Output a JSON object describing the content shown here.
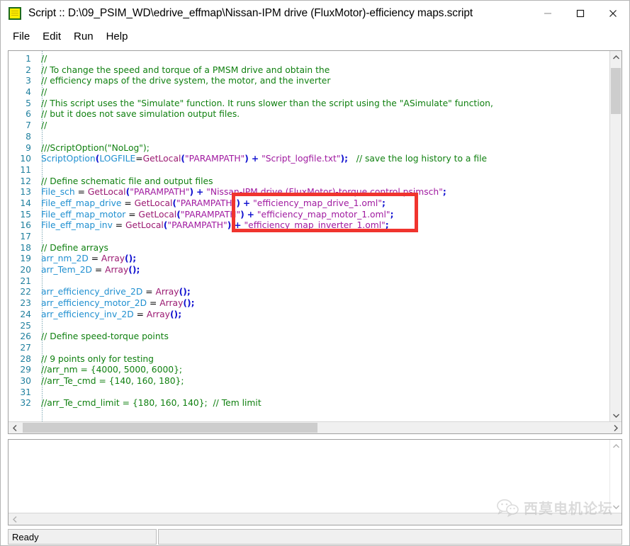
{
  "window": {
    "title": "Script :: D:\\09_PSIM_WD\\edrive_effmap\\Nissan-IPM drive (FluxMotor)-efficiency maps.script",
    "icon": "script-document-icon",
    "controls": {
      "minimize": "minimize-icon",
      "maximize": "maximize-icon",
      "close": "close-icon"
    }
  },
  "menubar": {
    "items": [
      {
        "label": "File"
      },
      {
        "label": "Edit"
      },
      {
        "label": "Run"
      },
      {
        "label": "Help"
      }
    ]
  },
  "editor": {
    "first_line": 1,
    "last_line": 32,
    "lines": [
      {
        "n": "1",
        "tokens": [
          {
            "t": "//",
            "c": "ct"
          }
        ]
      },
      {
        "n": "2",
        "tokens": [
          {
            "t": "// To change the speed and torque of a PMSM drive and obtain the",
            "c": "ct"
          }
        ]
      },
      {
        "n": "3",
        "tokens": [
          {
            "t": "// efficiency maps of the drive system, the motor, and the inverter",
            "c": "ct"
          }
        ]
      },
      {
        "n": "4",
        "tokens": [
          {
            "t": "//",
            "c": "ct"
          }
        ]
      },
      {
        "n": "5",
        "tokens": [
          {
            "t": "// This script uses the \"Simulate\" function. It runs slower than the script using the \"ASimulate\" function,",
            "c": "ct"
          }
        ]
      },
      {
        "n": "6",
        "tokens": [
          {
            "t": "// but it does not save simulation output files.",
            "c": "ct"
          }
        ]
      },
      {
        "n": "7",
        "tokens": [
          {
            "t": "//",
            "c": "ct"
          }
        ]
      },
      {
        "n": "8",
        "tokens": []
      },
      {
        "n": "9",
        "tokens": [
          {
            "t": "///ScriptOption(\"NoLog\");",
            "c": "ct"
          }
        ]
      },
      {
        "n": "10",
        "tokens": [
          {
            "t": "ScriptOption",
            "c": "id"
          },
          {
            "t": "(",
            "c": "pn"
          },
          {
            "t": "LOGFILE",
            "c": "id"
          },
          {
            "t": "=",
            "c": "op"
          },
          {
            "t": "GetLocal",
            "c": "fn"
          },
          {
            "t": "(",
            "c": "pn"
          },
          {
            "t": "\"PARAMPATH\"",
            "c": "st"
          },
          {
            "t": ")",
            "c": "pn"
          },
          {
            "t": " ",
            "c": "op"
          },
          {
            "t": "+",
            "c": "pn"
          },
          {
            "t": " ",
            "c": "op"
          },
          {
            "t": "\"Script_logfile.txt\"",
            "c": "st"
          },
          {
            "t": ")",
            "c": "pn"
          },
          {
            "t": ";",
            "c": "pn"
          },
          {
            "t": "   ",
            "c": "op"
          },
          {
            "t": "// save the log history to a file",
            "c": "ct"
          }
        ]
      },
      {
        "n": "11",
        "tokens": []
      },
      {
        "n": "12",
        "tokens": [
          {
            "t": "// Define schematic file and output files",
            "c": "ct"
          }
        ]
      },
      {
        "n": "13",
        "tokens": [
          {
            "t": "File_sch",
            "c": "id"
          },
          {
            "t": " = ",
            "c": "op"
          },
          {
            "t": "GetLocal",
            "c": "fn"
          },
          {
            "t": "(",
            "c": "pn"
          },
          {
            "t": "\"PARAMPATH\"",
            "c": "st"
          },
          {
            "t": ")",
            "c": "pn"
          },
          {
            "t": " ",
            "c": "op"
          },
          {
            "t": "+",
            "c": "pn"
          },
          {
            "t": " ",
            "c": "op"
          },
          {
            "t": "\"Nissan-IPM drive (FluxMotor)-torque control.psimsch\"",
            "c": "st"
          },
          {
            "t": ";",
            "c": "pn"
          }
        ]
      },
      {
        "n": "14",
        "tokens": [
          {
            "t": "File_eff_map_drive",
            "c": "id"
          },
          {
            "t": " = ",
            "c": "op"
          },
          {
            "t": "GetLocal",
            "c": "fn"
          },
          {
            "t": "(",
            "c": "pn"
          },
          {
            "t": "\"PARAMPATH\"",
            "c": "st"
          },
          {
            "t": ")",
            "c": "pn"
          },
          {
            "t": " ",
            "c": "op"
          },
          {
            "t": "+",
            "c": "pn"
          },
          {
            "t": " ",
            "c": "op"
          },
          {
            "t": "\"efficiency_map_drive_1.oml\"",
            "c": "st"
          },
          {
            "t": ";",
            "c": "pn"
          }
        ]
      },
      {
        "n": "15",
        "tokens": [
          {
            "t": "File_eff_map_motor",
            "c": "id"
          },
          {
            "t": " = ",
            "c": "op"
          },
          {
            "t": "GetLocal",
            "c": "fn"
          },
          {
            "t": "(",
            "c": "pn"
          },
          {
            "t": "\"PARAMPATH\"",
            "c": "st"
          },
          {
            "t": ")",
            "c": "pn"
          },
          {
            "t": " ",
            "c": "op"
          },
          {
            "t": "+",
            "c": "pn"
          },
          {
            "t": " ",
            "c": "op"
          },
          {
            "t": "\"efficiency_map_motor_1.oml\"",
            "c": "st"
          },
          {
            "t": ";",
            "c": "pn"
          }
        ]
      },
      {
        "n": "16",
        "tokens": [
          {
            "t": "File_eff_map_inv",
            "c": "id"
          },
          {
            "t": " = ",
            "c": "op"
          },
          {
            "t": "GetLocal",
            "c": "fn"
          },
          {
            "t": "(",
            "c": "pn"
          },
          {
            "t": "\"PARAMPATH\"",
            "c": "st"
          },
          {
            "t": ")",
            "c": "pn"
          },
          {
            "t": " ",
            "c": "op"
          },
          {
            "t": "+",
            "c": "pn"
          },
          {
            "t": " ",
            "c": "op"
          },
          {
            "t": "\"efficiency_map_inverter_1.oml\"",
            "c": "st"
          },
          {
            "t": ";",
            "c": "pn"
          }
        ]
      },
      {
        "n": "17",
        "tokens": []
      },
      {
        "n": "18",
        "tokens": [
          {
            "t": "// Define arrays",
            "c": "ct"
          }
        ]
      },
      {
        "n": "19",
        "tokens": [
          {
            "t": "arr_nm_2D",
            "c": "id"
          },
          {
            "t": " = ",
            "c": "op"
          },
          {
            "t": "Array",
            "c": "fn"
          },
          {
            "t": "()",
            "c": "pn"
          },
          {
            "t": ";",
            "c": "pn"
          }
        ]
      },
      {
        "n": "20",
        "tokens": [
          {
            "t": "arr_Tem_2D",
            "c": "id"
          },
          {
            "t": " = ",
            "c": "op"
          },
          {
            "t": "Array",
            "c": "fn"
          },
          {
            "t": "()",
            "c": "pn"
          },
          {
            "t": ";",
            "c": "pn"
          }
        ]
      },
      {
        "n": "21",
        "tokens": []
      },
      {
        "n": "22",
        "tokens": [
          {
            "t": "arr_efficiency_drive_2D",
            "c": "id"
          },
          {
            "t": " = ",
            "c": "op"
          },
          {
            "t": "Array",
            "c": "fn"
          },
          {
            "t": "()",
            "c": "pn"
          },
          {
            "t": ";",
            "c": "pn"
          }
        ]
      },
      {
        "n": "23",
        "tokens": [
          {
            "t": "arr_efficiency_motor_2D",
            "c": "id"
          },
          {
            "t": " = ",
            "c": "op"
          },
          {
            "t": "Array",
            "c": "fn"
          },
          {
            "t": "()",
            "c": "pn"
          },
          {
            "t": ";",
            "c": "pn"
          }
        ]
      },
      {
        "n": "24",
        "tokens": [
          {
            "t": "arr_efficiency_inv_2D",
            "c": "id"
          },
          {
            "t": " = ",
            "c": "op"
          },
          {
            "t": "Array",
            "c": "fn"
          },
          {
            "t": "()",
            "c": "pn"
          },
          {
            "t": ";",
            "c": "pn"
          }
        ]
      },
      {
        "n": "25",
        "tokens": []
      },
      {
        "n": "26",
        "tokens": [
          {
            "t": "// Define speed-torque points",
            "c": "ct"
          }
        ]
      },
      {
        "n": "27",
        "tokens": []
      },
      {
        "n": "28",
        "tokens": [
          {
            "t": "// 9 points only for testing",
            "c": "ct"
          }
        ]
      },
      {
        "n": "29",
        "tokens": [
          {
            "t": "//arr_nm = {4000, 5000, 6000};",
            "c": "ct"
          }
        ]
      },
      {
        "n": "30",
        "tokens": [
          {
            "t": "//arr_Te_cmd = {140, 160, 180};",
            "c": "ct"
          }
        ]
      },
      {
        "n": "31",
        "tokens": []
      },
      {
        "n": "32",
        "tokens": [
          {
            "t": "//arr_Te_cmd_limit = {180, 160, 140};  // Tem limit",
            "c": "ct"
          }
        ]
      }
    ],
    "annotation": {
      "shape": "rectangle",
      "color": "#f0342e",
      "covers_lines": [
        "14",
        "15",
        "16"
      ],
      "covers_text": "+ \"efficiency_map_drive_1.oml\"; + \"efficiency_map_motor_1.oml\"; \"efficiency_map_inverter_1.oml\";"
    },
    "scroll": {
      "vertical_up": "chevron-up-icon",
      "vertical_down": "chevron-down-icon",
      "horizontal_left": "chevron-left-icon",
      "horizontal_right": "chevron-right-icon"
    }
  },
  "output": {
    "text": "",
    "scroll": {
      "vertical_up": "chevron-up-icon",
      "vertical_down": "chevron-down-icon",
      "horizontal_left": "chevron-left-icon"
    }
  },
  "watermark": {
    "text": "西莫电机论坛",
    "icon": "wechat-bubble-icon"
  },
  "statusbar": {
    "message": "Ready",
    "secondary": ""
  },
  "colors": {
    "comment": "#108010",
    "identifier": "#1f8fd0",
    "function": "#9b1a72",
    "paren": "#1414d0",
    "string": "#a01aa0",
    "line_number": "#1f7f9e",
    "annotation": "#f0342e"
  }
}
